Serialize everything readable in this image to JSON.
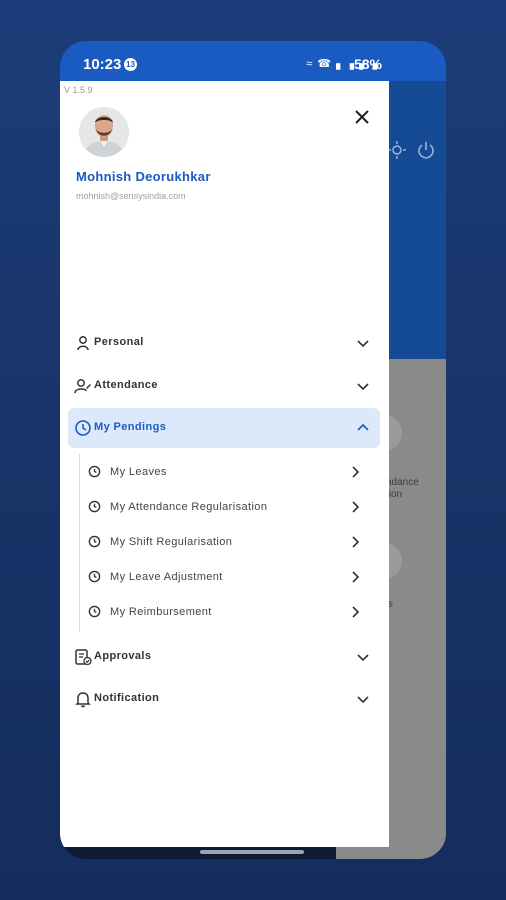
{
  "status_bar": {
    "time": "10:23",
    "notification_count": "13",
    "signal_icons": "≈ ☎ ▖▗ ▖▗",
    "battery": "58%"
  },
  "app_version": "V 1.5.9",
  "user": {
    "name": "Mohnish Deorukhkar",
    "email": "mohnish@sensysindia.com"
  },
  "background_partial_texts": [
    "ndance",
    "tion",
    "s"
  ],
  "menu": [
    {
      "label": "Personal",
      "icon": "person-icon",
      "expanded": false
    },
    {
      "label": "Attendance",
      "icon": "attendance-icon",
      "expanded": false
    },
    {
      "label": "My Pendings",
      "icon": "clock-icon",
      "expanded": true
    },
    {
      "label": "Approvals",
      "icon": "approvals-icon",
      "expanded": false
    },
    {
      "label": "Notification",
      "icon": "bell-icon",
      "expanded": false
    }
  ],
  "pendings_items": [
    {
      "label": "My Leaves"
    },
    {
      "label": "My Attendance Regularisation"
    },
    {
      "label": "My Shift Regularisation"
    },
    {
      "label": "My Leave Adjustment"
    },
    {
      "label": "My Reimbursement"
    }
  ],
  "colors": {
    "accent": "#1a5bc2",
    "active_bg": "#dbe9fb",
    "page_bg": "#183569"
  }
}
